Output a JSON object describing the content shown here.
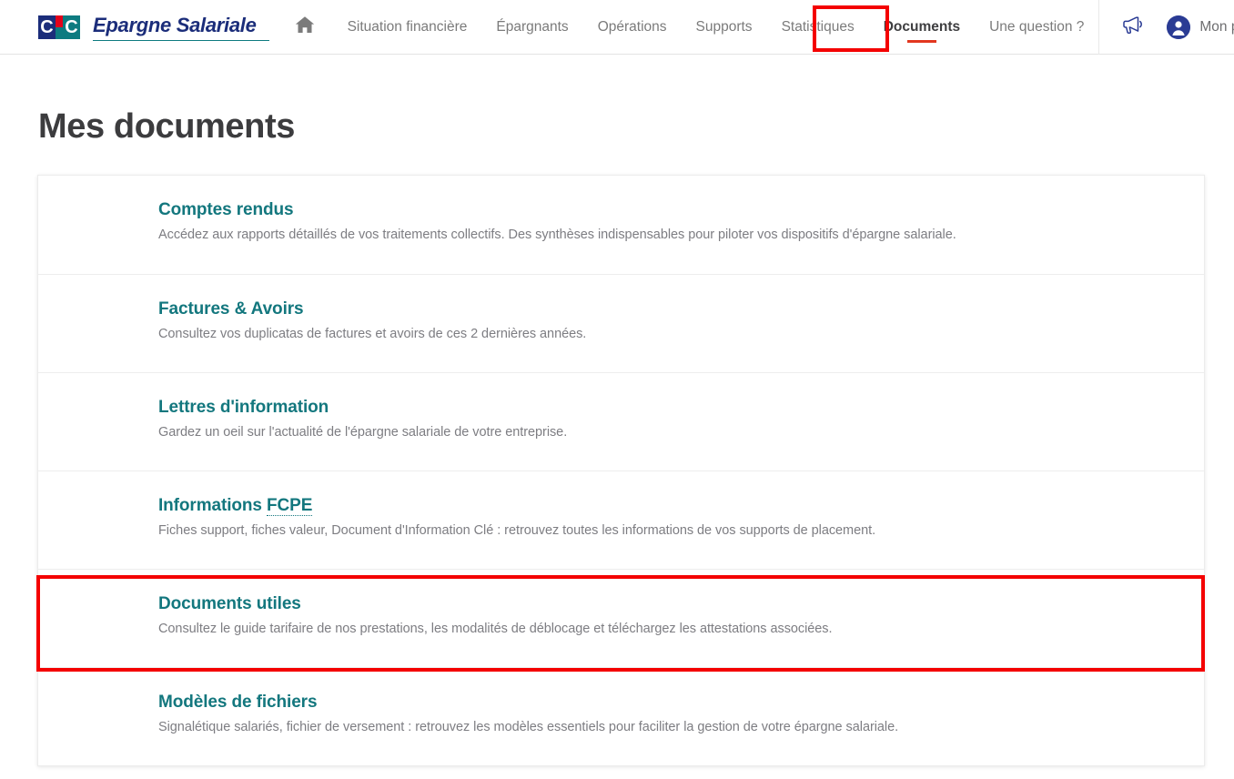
{
  "header": {
    "brand": {
      "logo_letter_left": "C",
      "logo_letter_right": "C",
      "name": "Epargne Salariale"
    },
    "home_icon": "home-icon",
    "nav_items": [
      {
        "label": "Situation financière",
        "active": false
      },
      {
        "label": "Épargnants",
        "active": false
      },
      {
        "label": "Opérations",
        "active": false
      },
      {
        "label": "Supports",
        "active": false
      },
      {
        "label": "Statistiques",
        "active": false
      },
      {
        "label": "Documents",
        "active": true
      },
      {
        "label": "Une question ?",
        "active": false
      }
    ],
    "announcements_icon": "megaphone-icon",
    "profile": {
      "label": "Mon profil",
      "avatar_icon": "user-avatar-icon",
      "chevron_icon": "chevron-down-icon"
    }
  },
  "main": {
    "page_title": "Mes documents",
    "documents": [
      {
        "title": "Comptes rendus",
        "description": "Accédez aux rapports détaillés de vos traitements collectifs. Des synthèses indispensables pour piloter vos dispositifs d'épargne salariale."
      },
      {
        "title": "Factures & Avoirs",
        "description": "Consultez vos duplicatas de factures et avoirs de ces 2 dernières années."
      },
      {
        "title": "Lettres d'information",
        "description": "Gardez un oeil sur l'actualité de l'épargne salariale de votre entreprise."
      },
      {
        "title_prefix": "Informations ",
        "title_abbr": "FCPE",
        "description": "Fiches support, fiches valeur, Document d'Information Clé : retrouvez toutes les informations de vos supports de placement."
      },
      {
        "title": "Documents utiles",
        "description": "Consultez le guide tarifaire de nos prestations, les modalités de déblocage et téléchargez les attestations associées."
      },
      {
        "title": "Modèles de fichiers",
        "description": "Signalétique salariés, fichier de versement : retrouvez les modèles essentiels pour faciliter la gestion de votre épargne salariale."
      }
    ]
  },
  "annotations": {
    "highlight_color": "#f40000",
    "nav_highlight_target": "Documents",
    "row_highlight_target": "Documents utiles"
  },
  "colors": {
    "brand_blue": "#1b2d7a",
    "brand_teal": "#0d7b80",
    "brand_red": "#e2001a",
    "link_teal": "#13777e",
    "active_underline": "#e2371f",
    "nav_text": "#7b7b7b",
    "body_text": "#7d7d82",
    "title_text": "#3c3c3e"
  }
}
